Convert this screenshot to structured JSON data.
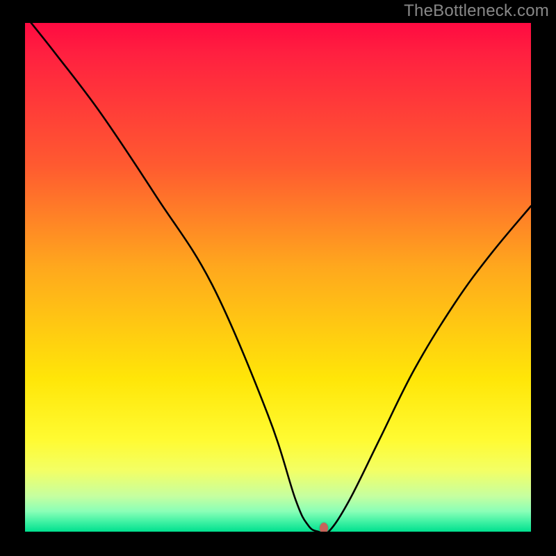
{
  "watermark": {
    "text": "TheBottleneck.com"
  },
  "chart_data": {
    "type": "line",
    "title": "",
    "xlabel": "",
    "ylabel": "",
    "xlim": [
      0,
      1000
    ],
    "ylim": [
      0,
      1000
    ],
    "grid": false,
    "legend": false,
    "background_gradient": [
      "#ff0a41",
      "#ff5a30",
      "#ffa81d",
      "#ffe608",
      "#fffb32",
      "#c6ffa0",
      "#42f2a4",
      "#00e08f"
    ],
    "series": [
      {
        "name": "bottleneck-curve",
        "x": [
          0,
          60,
          150,
          260,
          370,
          480,
          535,
          560,
          580,
          600,
          640,
          700,
          770,
          850,
          920,
          1000
        ],
        "y": [
          1015,
          940,
          822,
          658,
          485,
          230,
          62,
          12,
          0,
          0,
          60,
          180,
          320,
          450,
          545,
          640
        ]
      }
    ],
    "marker": {
      "x": 590,
      "y": 0,
      "color": "#c8635a"
    }
  }
}
